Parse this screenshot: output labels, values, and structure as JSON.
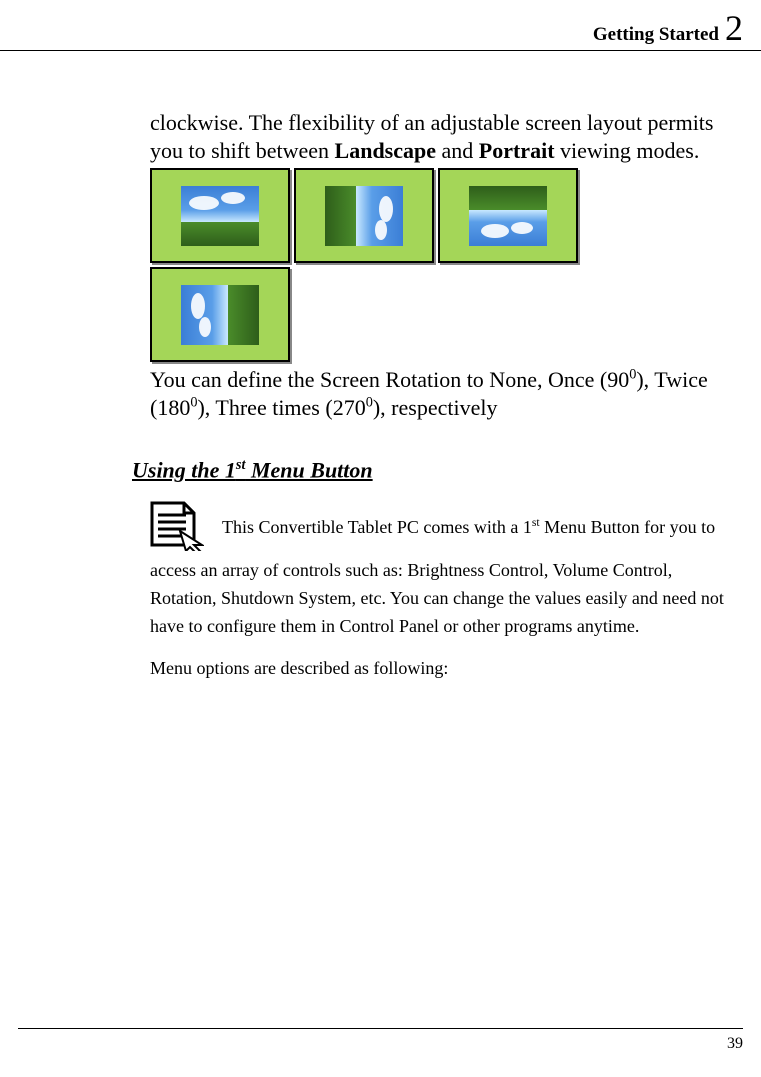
{
  "header": {
    "title": "Getting Started",
    "chapter": "2"
  },
  "page_number": "39",
  "body": {
    "para1_pre": "clockwise.   The   flexibility of an adjustable screen layout permits you to shift between ",
    "landscape": "Landscape",
    "and": " and ",
    "portrait": "Portrait",
    "para1_post": " viewing modes.",
    "para2": "You can define the Screen Rotation to None, Once (90",
    "sup0_1": "0",
    "para2_b": "), Twice (180",
    "sup0_2": "0",
    "para2_c": "), Three times (270",
    "sup0_3": "0",
    "para2_d": "), respectively"
  },
  "section": {
    "heading_pre": "Using the 1",
    "heading_sup": "st",
    "heading_post": " Menu Button",
    "icon_para_a": "This Convertible Tablet PC comes with a 1",
    "icon_para_sup": "st",
    "icon_para_b": " Menu Button for you to access an array of controls such as: Brightness Control, Volume Control, Rotation, Shutdown System, etc. You can change the values easily   and need not   have to configure them in Control Panel or other programs anytime.",
    "final": "Menu options are described as following:"
  }
}
